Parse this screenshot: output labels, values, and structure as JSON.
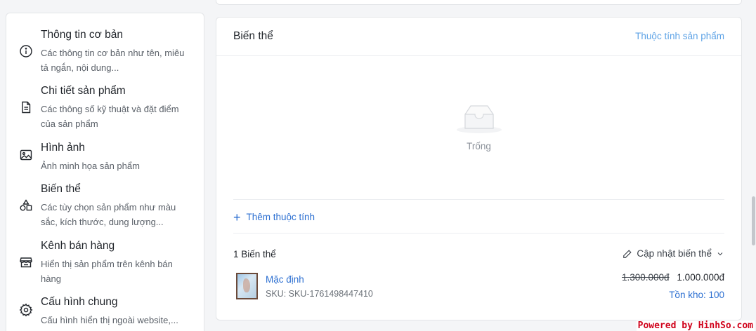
{
  "nav": {
    "items": [
      {
        "title": "Thông tin cơ bản",
        "desc": "Các thông tin cơ bản như tên, miêu tả ngắn, nội dung..."
      },
      {
        "title": "Chi tiết sản phẩm",
        "desc": "Các thông số kỹ thuật và đặt điểm của sản phẩm"
      },
      {
        "title": "Hình ảnh",
        "desc": "Ảnh minh họa sản phẩm"
      },
      {
        "title": "Biến thể",
        "desc": "Các tùy chọn sản phẩm như màu sắc, kích thước, dung lượng..."
      },
      {
        "title": "Kênh bán hàng",
        "desc": "Hiển thị sản phẩm trên kênh bán hàng"
      },
      {
        "title": "Cấu hình chung",
        "desc": "Cấu hình hiển thị ngoài website,..."
      }
    ]
  },
  "variant_card": {
    "title": "Biến thể",
    "attributes_link": "Thuộc tính sản phẩm",
    "empty_text": "Trống",
    "add_attribute": "Thêm thuộc tính",
    "count_label": "1 Biến thể",
    "update_label": "Cập nhật biến thể",
    "variant": {
      "name": "Mặc định",
      "sku": "SKU: SKU-1761498447410",
      "old_price": "1.300.000đ",
      "new_price": "1.000.000đ",
      "stock": "Tồn kho: 100"
    }
  },
  "footer": {
    "brand": "Powered by HinhSo.com"
  },
  "colors": {
    "link": "#2c6fd1",
    "link_light": "#5ea3e6",
    "brand_footer": "#d0021b"
  }
}
